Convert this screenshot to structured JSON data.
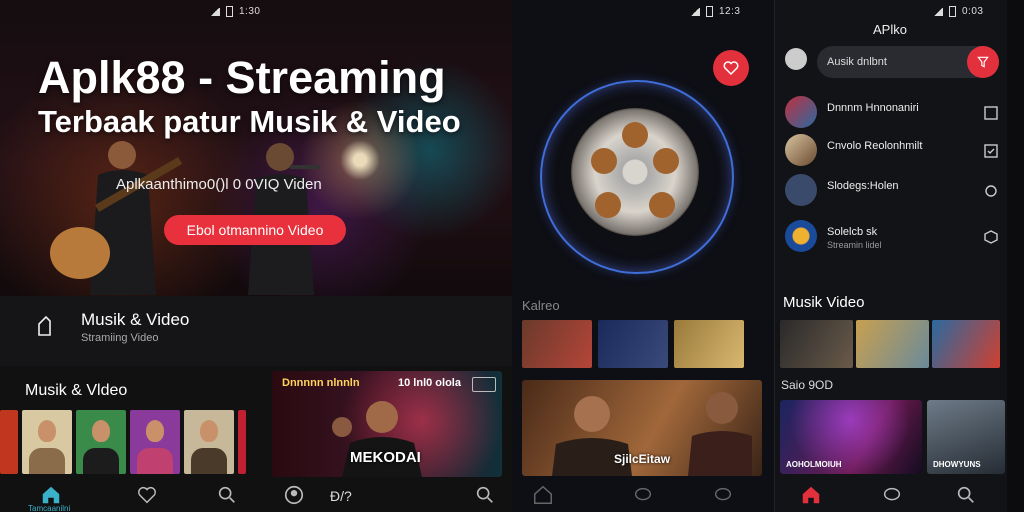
{
  "panel1": {
    "status_time": "1:30",
    "hero": {
      "title": "Aplk88 - Streaming",
      "subtitle": "Terbaak patur Musik & Video",
      "tagline": "Aplkaanthimo0()l 0 0VIQ Viden",
      "button": "Ebol otmannino Video"
    },
    "section": {
      "title": "Musik & Video",
      "subtitle": "Stramiing Video"
    },
    "section2_title": "Musik & Vldeo",
    "featured": {
      "title": "Dnnnnn nlnnln",
      "number": "10 lnl0 olola",
      "label": "MEKODAI"
    },
    "nav": {
      "home_label": "Tamcaanilni",
      "extra_label": "Đ/?"
    }
  },
  "panel2": {
    "status_time": "12:3",
    "section_title": "Kalreo",
    "featured_label": "SjilcEitaw"
  },
  "panel3": {
    "status_time": "0:03",
    "app_title": "APlko",
    "search_text": "Ausik dnlbnt",
    "list": [
      {
        "title": "Dnnnm Hnnonaniri",
        "subtitle": ""
      },
      {
        "title": "Cnvolo Reolonhmilt",
        "subtitle": ""
      },
      {
        "title": "Slodegs:Holen",
        "subtitle": ""
      },
      {
        "title": "Solelcb sk",
        "subtitle": "Streamin lidel"
      }
    ],
    "section_title": "Musik Video",
    "section2_title": "Saio   9OD",
    "big_label": "AOHOLMOIUH",
    "big_label2": "DHOWYUNS"
  },
  "colors": {
    "accent": "#e2313c",
    "background": "#0c0c0e",
    "nav_active": "#3ab0c9"
  }
}
